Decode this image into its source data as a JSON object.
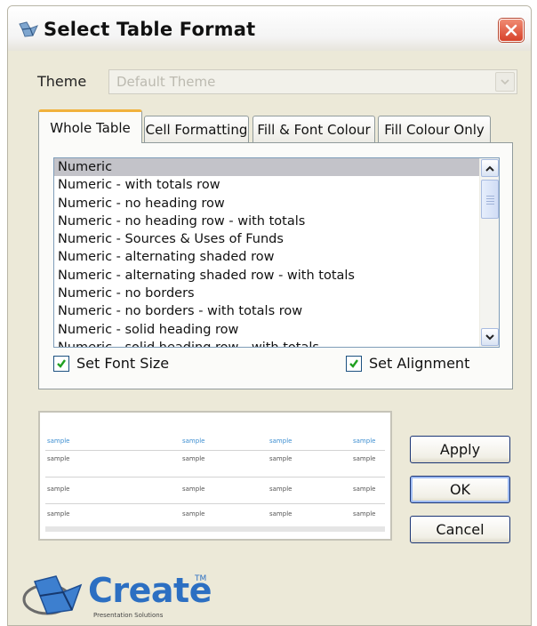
{
  "window": {
    "title": "Select Table Format"
  },
  "theme": {
    "label": "Theme",
    "value": "Default Theme"
  },
  "tabs": [
    {
      "label": "Whole Table",
      "active": true
    },
    {
      "label": "Cell Formatting",
      "active": false
    },
    {
      "label": "Fill & Font Colour",
      "active": false
    },
    {
      "label": "Fill Colour Only",
      "active": false
    }
  ],
  "format_list": {
    "selected_index": 0,
    "items": [
      "Numeric",
      "Numeric - with totals row",
      "Numeric - no heading row",
      "Numeric - no heading row - with totals",
      "Numeric - Sources & Uses of Funds",
      "Numeric - alternating shaded row",
      "Numeric - alternating shaded row - with totals",
      "Numeric - no borders",
      "Numeric - no borders - with totals row",
      "Numeric - solid heading row",
      "Numeric - solid heading row - with totals"
    ]
  },
  "options": {
    "set_font_size": {
      "label": "Set Font Size",
      "checked": true
    },
    "set_alignment": {
      "label": "Set Alignment",
      "checked": true
    }
  },
  "preview": {
    "headers": [
      "sample",
      "sample",
      "sample",
      "sample"
    ],
    "rows": [
      [
        "sample",
        "sample",
        "sample",
        "sample"
      ],
      [
        "sample",
        "sample",
        "sample",
        "sample"
      ],
      [
        "sample",
        "sample",
        "sample",
        "sample"
      ]
    ]
  },
  "buttons": {
    "apply": "Apply",
    "ok": "OK",
    "cancel": "Cancel"
  },
  "logo": {
    "text": "Create",
    "trademark": "TM",
    "subtitle": "Presentation Solutions"
  },
  "colors": {
    "accent_tab": "#f1b23d",
    "close": "#d7422a",
    "logo": "#2c6fc2",
    "selection": "#c3c3c9"
  },
  "icons": [
    "app-icon",
    "close-icon",
    "dropdown-arrow-icon",
    "scroll-up-icon",
    "scroll-down-icon",
    "checkmark-icon",
    "create-logo-icon"
  ]
}
